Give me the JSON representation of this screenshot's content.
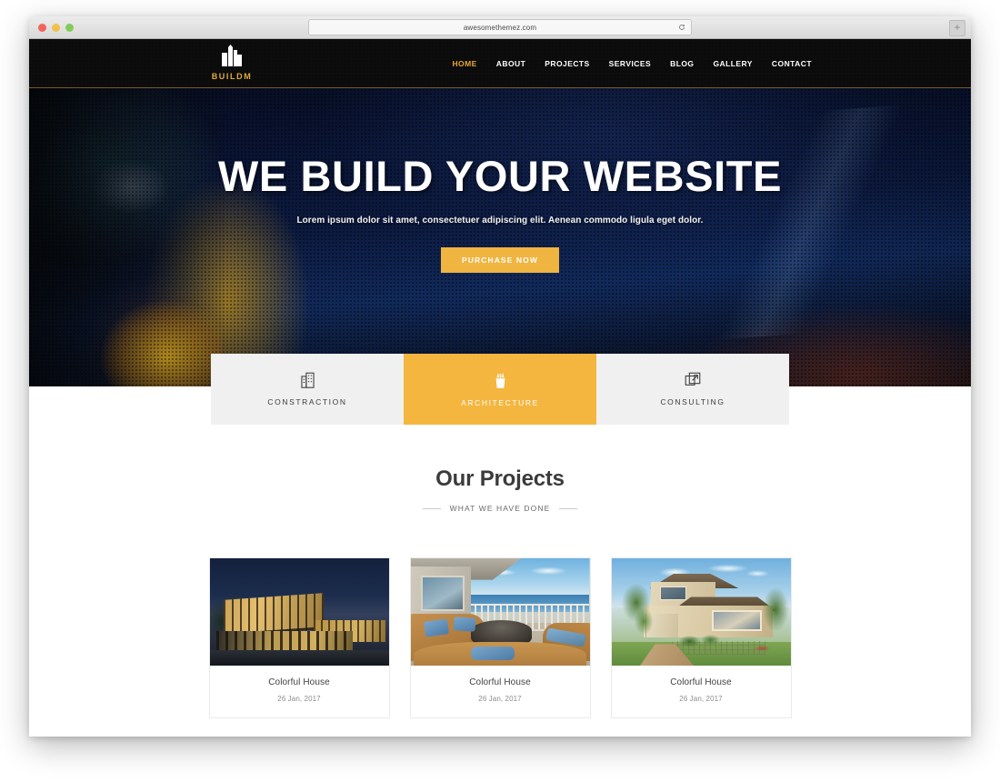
{
  "browser": {
    "url": "awesomethemez.com",
    "reload_icon": "reload-icon",
    "new_tab_label": "+",
    "traffic_lights": [
      "close",
      "minimize",
      "maximize"
    ]
  },
  "site": {
    "header": {
      "brand": {
        "name": "BUILDM",
        "icon": "building-logo-icon"
      },
      "nav": [
        {
          "label": "HOME",
          "active": true
        },
        {
          "label": "ABOUT",
          "active": false
        },
        {
          "label": "PROJECTS",
          "active": false
        },
        {
          "label": "SERVICES",
          "active": false
        },
        {
          "label": "BLOG",
          "active": false
        },
        {
          "label": "GALLERY",
          "active": false
        },
        {
          "label": "CONTACT",
          "active": false
        }
      ]
    },
    "hero": {
      "title": "WE BUILD YOUR WEBSITE",
      "subtitle": "Lorem ipsum dolor sit amet, consectetuer adipiscing elit. Aenean commodo ligula eget dolor.",
      "cta_label": "PURCHASE NOW",
      "background_description": "construction excavator halftone photo"
    },
    "service_tabs": [
      {
        "label": "CONSTRACTION",
        "icon": "office-building-icon",
        "active": false
      },
      {
        "label": "ARCHITECTURE",
        "icon": "pencil-cup-icon",
        "active": true
      },
      {
        "label": "CONSULTING",
        "icon": "external-link-icon",
        "active": false
      }
    ],
    "projects_section": {
      "title": "Our Projects",
      "subtitle": "WHAT WE HAVE DONE",
      "cards": [
        {
          "name": "Colorful House",
          "date": "26 Jan, 2017",
          "thumb": "modern-glass-building-dusk"
        },
        {
          "name": "Colorful House",
          "date": "26 Jan, 2017",
          "thumb": "deck-lounge-ocean-view"
        },
        {
          "name": "Colorful House",
          "date": "26 Jan, 2017",
          "thumb": "suburban-two-story-house"
        }
      ]
    }
  },
  "colors": {
    "accent_gold": "#f4b63f",
    "brand_gold": "#e2a93c",
    "hero_cta": "#f0b440",
    "header_bg": "#0b0b0b",
    "tab_inactive_bg": "#f0f0f0",
    "heading_text": "#3b3b3b"
  }
}
